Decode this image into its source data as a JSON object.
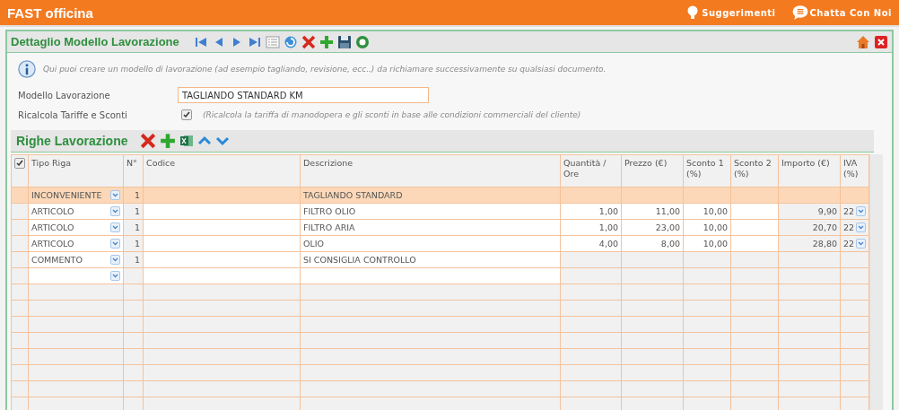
{
  "app_title": "FAST officina",
  "top_links": [
    {
      "kind": "bulb",
      "label": "Suggerimenti"
    },
    {
      "kind": "chat",
      "label": "Chatta Con Noi"
    }
  ],
  "panel_title": "Dettaglio Modello Lavorazione",
  "info": "Qui puoi creare un modello di lavorazione (ad esempio tagliando, revisione, ecc..) da richiamare successivamente su qualsiasi documento.",
  "fields": {
    "model_label": "Modello Lavorazione",
    "model_value": "TAGLIANDO STANDARD KM",
    "recalc_label": "Ricalcola Tariffe e Sconti",
    "recalc_checked": true,
    "recalc_note": "(Ricalcola la tariffa di manodopera e gli sconti in base alle condizioni commerciali del cliente)"
  },
  "section_title": "Righe Lavorazione",
  "table": {
    "select_all_checked": true,
    "columns": [
      "Tipo Riga",
      "N°",
      "Codice",
      "Descrizione",
      "Quantità / Ore",
      "Prezzo (€)",
      "Sconto 1 (%)",
      "Sconto 2 (%)",
      "Importo (€)",
      "IVA (%)"
    ],
    "rows": [
      {
        "selected": true,
        "tipo": "INCONVENIENTE",
        "n": "1",
        "descrizione": "TAGLIANDO STANDARD"
      },
      {
        "selected": false,
        "tipo": "ARTICOLO",
        "n": "1",
        "descrizione": "FILTRO OLIO",
        "qta": "1,00",
        "prezzo": "11,00",
        "sconto1": "10,00",
        "importo": "9,90",
        "iva": "22"
      },
      {
        "selected": false,
        "tipo": "ARTICOLO",
        "n": "1",
        "descrizione": "FILTRO ARIA",
        "qta": "1,00",
        "prezzo": "23,00",
        "sconto1": "10,00",
        "importo": "20,70",
        "iva": "22"
      },
      {
        "selected": false,
        "tipo": "ARTICOLO",
        "n": "1",
        "descrizione": "OLIO",
        "qta": "4,00",
        "prezzo": "8,00",
        "sconto1": "10,00",
        "importo": "28,80",
        "iva": "22"
      },
      {
        "selected": false,
        "tipo": "COMMENTO",
        "n": "1",
        "descrizione": "SI CONSIGLIA CONTROLLO"
      },
      {
        "selected": false
      }
    ]
  }
}
